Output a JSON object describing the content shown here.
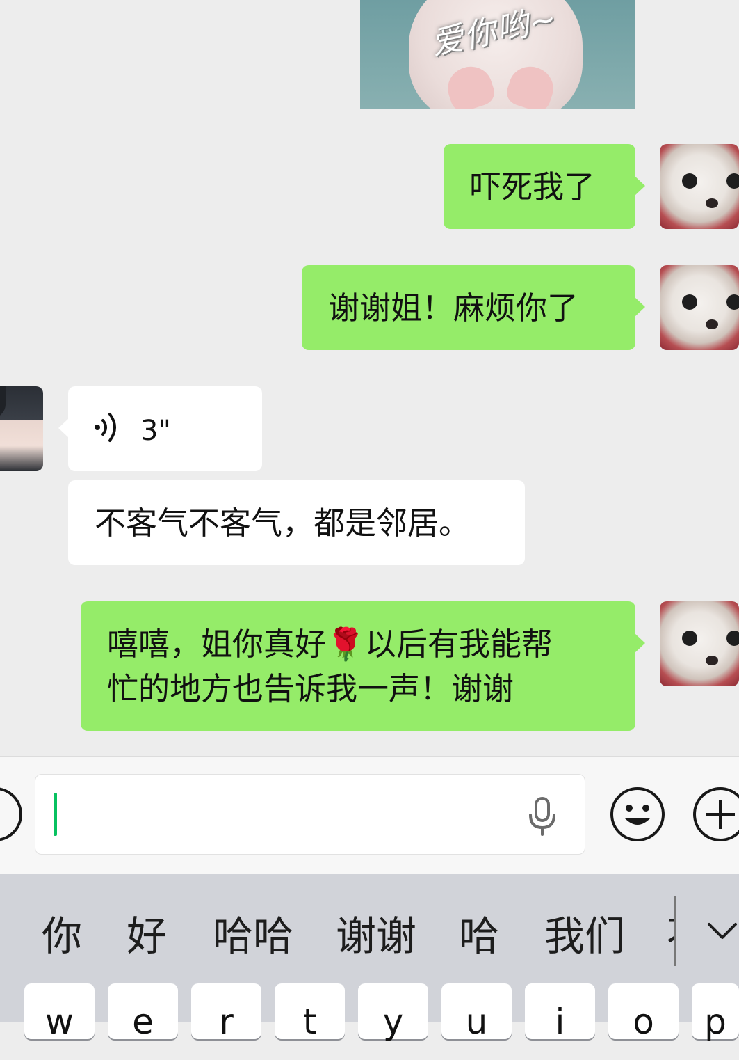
{
  "sticker": {
    "caption": "爱你哟~"
  },
  "messages": [
    {
      "id": "m1",
      "from": "me",
      "text": "吓死我了"
    },
    {
      "id": "m2",
      "from": "me",
      "text": "谢谢姐！麻烦你了"
    },
    {
      "id": "m3",
      "from": "them",
      "type": "voice",
      "duration": "3\""
    },
    {
      "id": "m4",
      "from": "them",
      "text": "不客气不客气，都是邻居。"
    },
    {
      "id": "m5",
      "from": "me",
      "text_line1": "嘻嘻，姐你真好🌹以后有我能帮",
      "text_line2": "忙的地方也告诉我一声！谢谢"
    }
  ],
  "input": {
    "value": "",
    "placeholder": ""
  },
  "candidates": [
    "你",
    "好",
    "哈哈",
    "谢谢",
    "哈",
    "我们"
  ],
  "candidate_partial": "不",
  "keys": [
    "w",
    "e",
    "r",
    "t",
    "y",
    "u",
    "i",
    "o",
    "p"
  ],
  "colors": {
    "my_bubble": "#95ec69",
    "their_bubble": "#ffffff",
    "chat_bg": "#ededed",
    "caret": "#07c160",
    "keyboard_bg": "#d1d3d9"
  },
  "icons": [
    "voice-wave-icon",
    "microphone-icon",
    "emoji-icon",
    "plus-icon",
    "chevron-down-icon"
  ]
}
